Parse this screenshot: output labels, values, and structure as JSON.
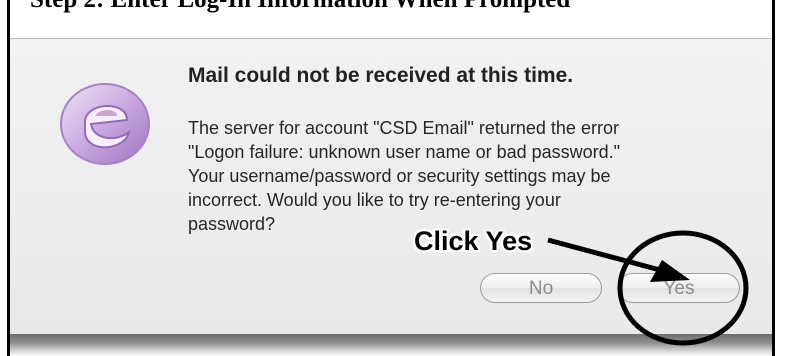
{
  "caption": "Step 2: Enter Log-In Information When Prompted",
  "dialog": {
    "title": "Mail could not be received at this time.",
    "message_lines": [
      "The server for account \"CSD Email\" returned the error",
      "\"Logon failure: unknown user name or bad password.\"",
      "Your username/password or security settings may be",
      "incorrect. Would you like to try re-entering your",
      "password?"
    ],
    "buttons": {
      "no": "No",
      "yes": "Yes"
    }
  },
  "annotation": {
    "label": "Click Yes"
  },
  "icons": {
    "app": "entourage-e-icon"
  },
  "colors": {
    "icon_purple": "#b58fd0",
    "annotation": "#000000"
  }
}
